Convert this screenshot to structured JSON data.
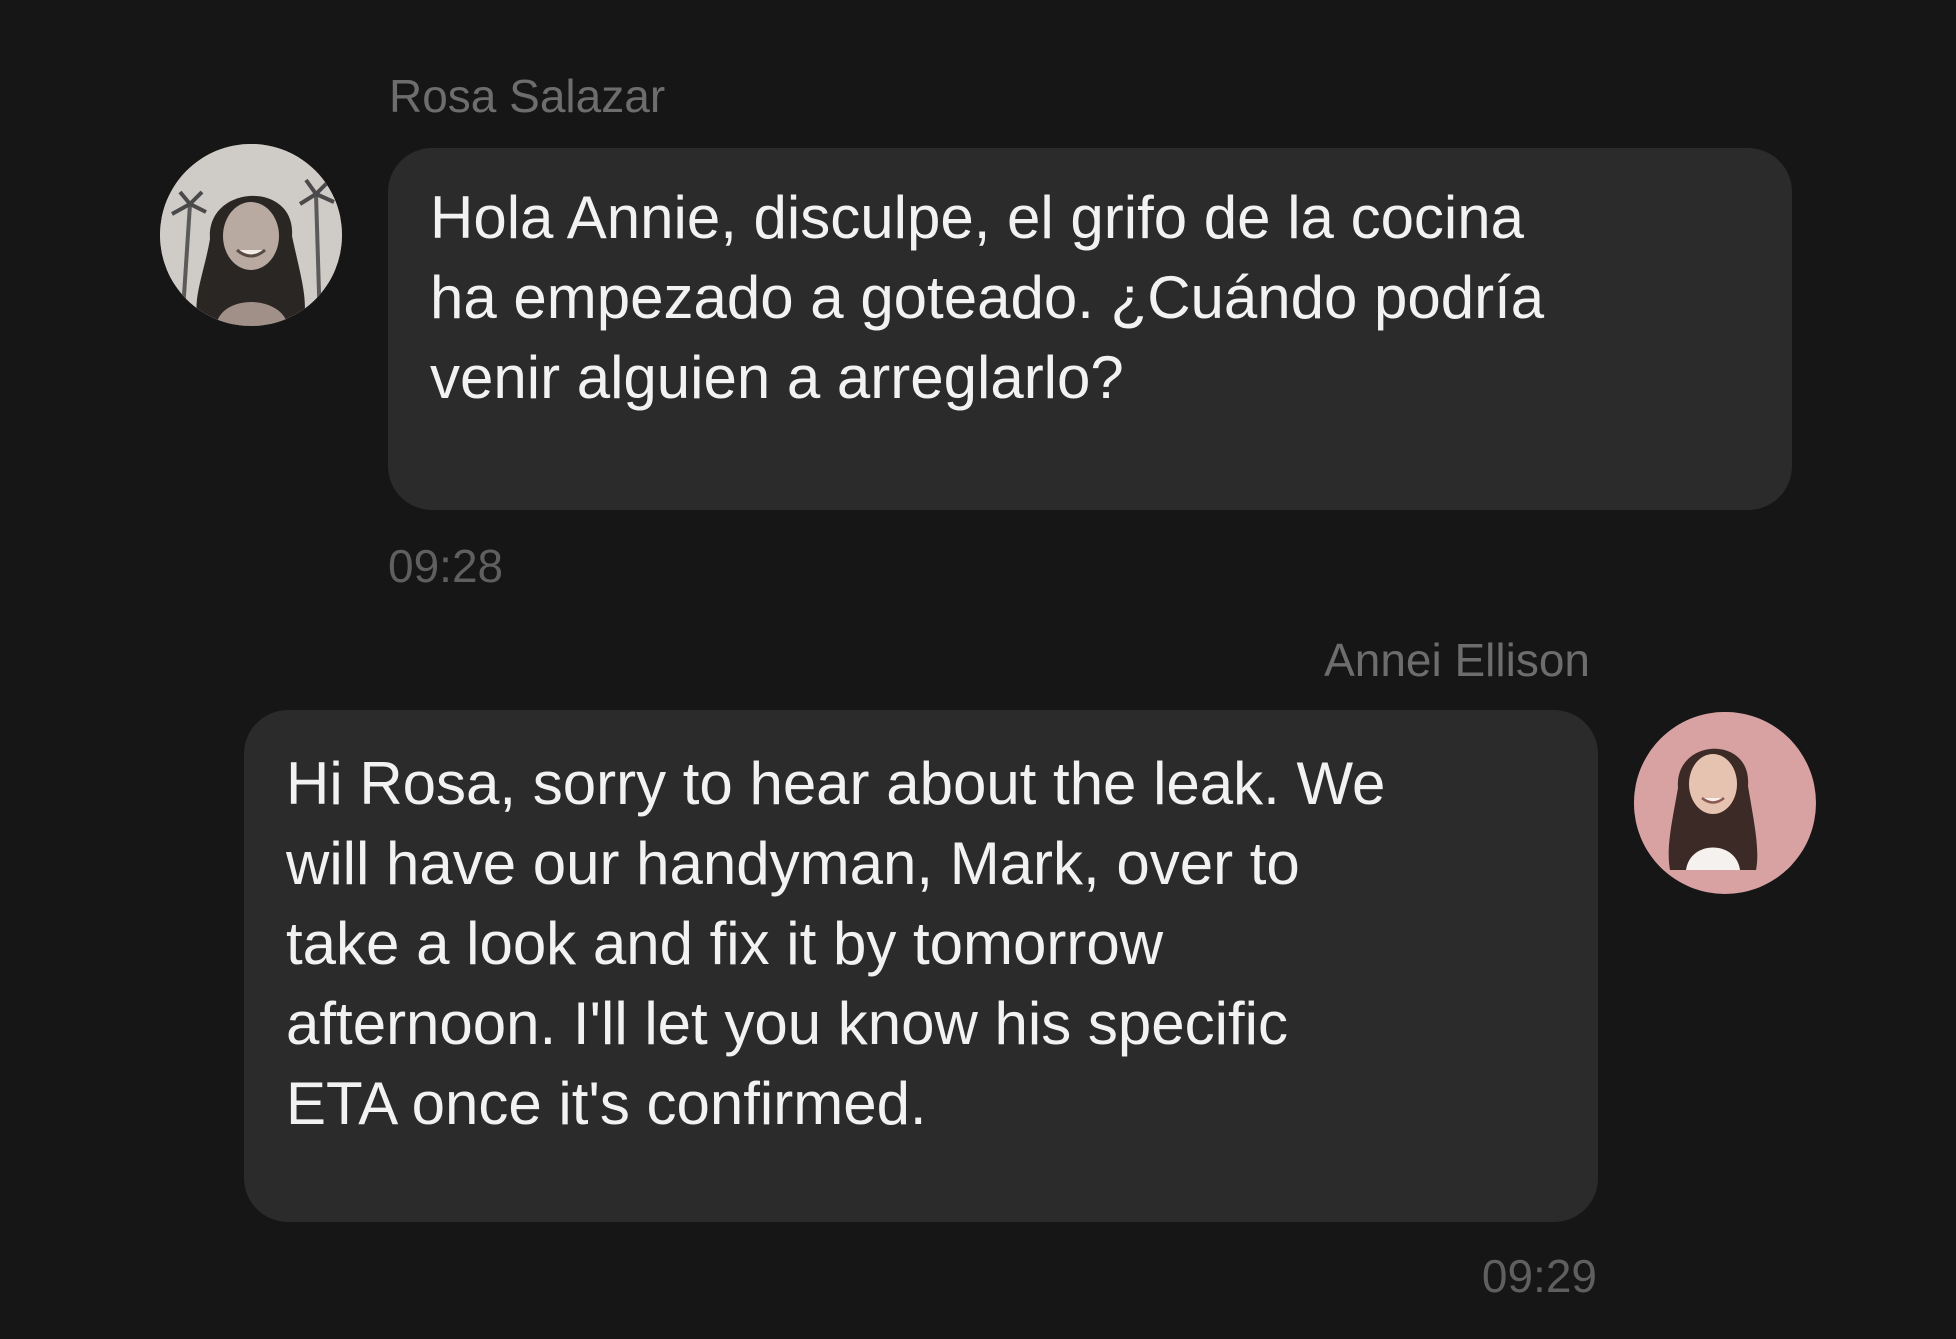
{
  "conversation": {
    "messages": [
      {
        "direction": "incoming",
        "sender": "Rosa Salazar",
        "avatar_icon": "user-photo-avatar",
        "text": "Hola Annie, disculpe, el grifo de la cocina\nha empezado a goteado. ¿Cuándo podría\nvenir alguien a arreglarlo?",
        "time": "09:28"
      },
      {
        "direction": "outgoing",
        "sender": "Annei Ellison",
        "avatar_icon": "user-photo-avatar",
        "text": "Hi Rosa, sorry to hear about the leak. We\nwill have our handyman, Mark, over to\ntake a look and fix it by tomorrow\nafternoon. I'll let you know his specific\nETA once it's confirmed.",
        "time": "09:29"
      }
    ]
  },
  "colors": {
    "background": "#161616",
    "bubble": "#2b2b2b",
    "message_text": "#f2f2f2",
    "meta_text": "#6d6d6d"
  }
}
